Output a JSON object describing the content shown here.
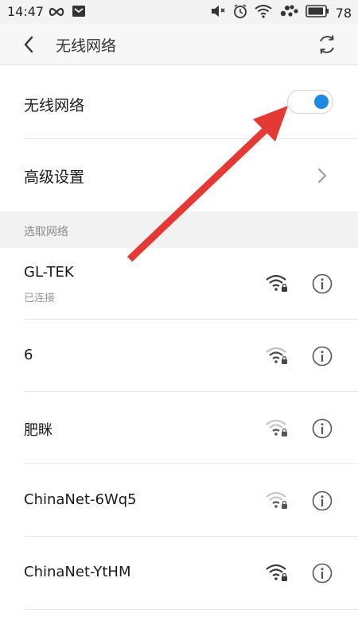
{
  "status_bar": {
    "time": "14:47",
    "battery": "78",
    "icons": [
      "infinity-icon",
      "mail-icon",
      "mute-icon",
      "alarm-icon",
      "wifi-icon",
      "paw-icon",
      "battery-icon"
    ]
  },
  "app_bar": {
    "title": "无线网络",
    "back_icon": "chevron-left-icon",
    "refresh_icon": "refresh-icon"
  },
  "wifi_toggle": {
    "label": "无线网络",
    "on": true,
    "accent": "#1e88e5"
  },
  "advanced": {
    "label": "高级设置"
  },
  "section": {
    "label": "选取网络"
  },
  "networks": [
    {
      "name": "GL-TEK",
      "status": "已连接"
    },
    {
      "name": "6",
      "status": ""
    },
    {
      "name": "肥眯",
      "status": ""
    },
    {
      "name": "ChinaNet-6Wq5",
      "status": ""
    },
    {
      "name": "ChinaNet-YtHM",
      "status": ""
    }
  ],
  "annotation": {
    "color": "#e53935"
  }
}
